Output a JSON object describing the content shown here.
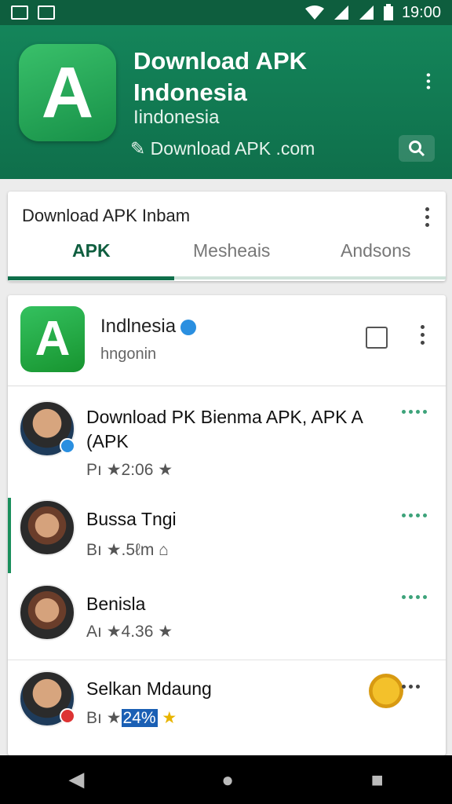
{
  "status_bar": {
    "time": "19:00",
    "icons": [
      "image-icon",
      "gallery-icon",
      "wifi-icon",
      "signal-icon",
      "signal-icon",
      "battery-icon"
    ]
  },
  "header": {
    "logo_letter": "A",
    "title": "Download APK Indonesia",
    "subtitle": "Iindonesia",
    "domain": "Download APK .com",
    "domain_icon": "link-icon",
    "menu_icon": "more-vert-icon",
    "search_icon": "search-icon",
    "color": "#0f6f4b"
  },
  "tabs_card": {
    "title": "Download APK Inbam",
    "tabs": [
      {
        "label": "APK",
        "active": true
      },
      {
        "label": "Mesheais",
        "active": false
      },
      {
        "label": "Andsons",
        "active": false
      }
    ]
  },
  "page": {
    "logo_letter": "A",
    "name": "Indlnesia",
    "sub": "hngonin",
    "icons": [
      "verified-icon",
      "share-icon",
      "more-vert-icon"
    ]
  },
  "items": [
    {
      "title": "Download PK Bienma APK, APK  A (APK",
      "meta_prefix": "Pı",
      "meta_value": "2:06",
      "badge": "blue"
    },
    {
      "title": "Bussa Tngi",
      "meta_prefix": "Bı",
      "meta_value": ".5ℓm",
      "badge": ""
    },
    {
      "title": "Benisla",
      "meta_prefix": "Aı",
      "meta_value": "4.36",
      "badge": ""
    },
    {
      "title": "Selkan Mdaung",
      "meta_prefix": "Bı",
      "meta_value": "24%",
      "badge": "red"
    }
  ],
  "nav": {
    "back": "back-icon",
    "home": "home-icon",
    "recents": "recents-icon"
  },
  "accent": "#1a8f5c"
}
